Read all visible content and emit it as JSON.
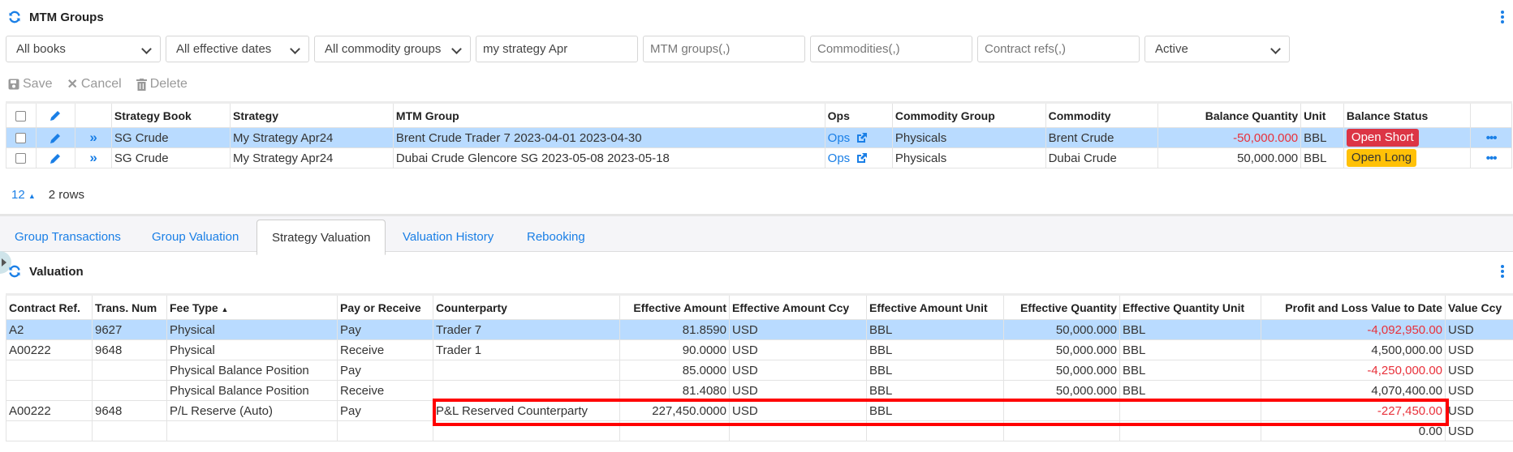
{
  "top_panel": {
    "title": "MTM Groups",
    "filters": {
      "books": "All books",
      "effective_dates": "All effective dates",
      "commodity_groups": "All commodity groups",
      "strategy_search_value": "my strategy Apr",
      "mtm_groups_placeholder": "MTM groups(,)",
      "commodities_placeholder": "Commodities(,)",
      "contract_refs_placeholder": "Contract refs(,)",
      "status": "Active"
    },
    "toolbar": {
      "save": "Save",
      "cancel": "Cancel",
      "delete": "Delete"
    },
    "table": {
      "columns": [
        "Strategy Book",
        "Strategy",
        "MTM Group",
        "Ops",
        "Commodity Group",
        "Commodity",
        "Balance Quantity",
        "Unit",
        "Balance Status"
      ],
      "rows": [
        {
          "strategy_book": "SG Crude",
          "strategy": "My Strategy Apr24",
          "mtm_group": "Brent Crude Trader 7 2023-04-01 2023-04-30",
          "ops": "Ops",
          "commodity_group": "Physicals",
          "commodity": "Brent Crude",
          "balance_quantity": "-50,000.000",
          "unit": "BBL",
          "balance_status": "Open Short",
          "selected": true
        },
        {
          "strategy_book": "SG Crude",
          "strategy": "My Strategy Apr24",
          "mtm_group": "Dubai Crude Glencore SG 2023-05-08 2023-05-18",
          "ops": "Ops",
          "commodity_group": "Physicals",
          "commodity": "Dubai Crude",
          "balance_quantity": "50,000.000",
          "unit": "BBL",
          "balance_status": "Open Long",
          "selected": false
        }
      ]
    },
    "pager": {
      "page_size": "12",
      "row_count": "2 rows"
    }
  },
  "tabs": [
    "Group Transactions",
    "Group Valuation",
    "Strategy Valuation",
    "Valuation History",
    "Rebooking"
  ],
  "active_tab": "Strategy Valuation",
  "valuation_panel": {
    "title": "Valuation",
    "table": {
      "columns": [
        "Contract Ref.",
        "Trans. Num",
        "Fee Type",
        "Pay or Receive",
        "Counterparty",
        "Effective Amount",
        "Effective Amount Ccy",
        "Effective Amount Unit",
        "Effective Quantity",
        "Effective Quantity Unit",
        "Profit and Loss Value to Date",
        "Value Ccy"
      ],
      "sort_indicator": "▲",
      "rows": [
        {
          "contract_ref": "A2",
          "trans_num": "9627",
          "fee_type": "Physical",
          "pay_receive": "Pay",
          "counterparty": "Trader 7",
          "eff_amount": "81.8590",
          "eff_amount_ccy": "USD",
          "eff_amount_unit": "BBL",
          "eff_qty": "50,000.000",
          "eff_qty_unit": "BBL",
          "pnl": "-4,092,950.00",
          "value_ccy": "USD",
          "selected": true
        },
        {
          "contract_ref": "A00222",
          "trans_num": "9648",
          "fee_type": "Physical",
          "pay_receive": "Receive",
          "counterparty": "Trader 1",
          "eff_amount": "90.0000",
          "eff_amount_ccy": "USD",
          "eff_amount_unit": "BBL",
          "eff_qty": "50,000.000",
          "eff_qty_unit": "BBL",
          "pnl": "4,500,000.00",
          "value_ccy": "USD"
        },
        {
          "contract_ref": "",
          "trans_num": "",
          "fee_type": "Physical Balance Position",
          "pay_receive": "Pay",
          "counterparty": "",
          "eff_amount": "85.0000",
          "eff_amount_ccy": "USD",
          "eff_amount_unit": "BBL",
          "eff_qty": "50,000.000",
          "eff_qty_unit": "BBL",
          "pnl": "-4,250,000.00",
          "value_ccy": "USD"
        },
        {
          "contract_ref": "",
          "trans_num": "",
          "fee_type": "Physical Balance Position",
          "pay_receive": "Receive",
          "counterparty": "",
          "eff_amount": "81.4080",
          "eff_amount_ccy": "USD",
          "eff_amount_unit": "BBL",
          "eff_qty": "50,000.000",
          "eff_qty_unit": "BBL",
          "pnl": "4,070,400.00",
          "value_ccy": "USD"
        },
        {
          "contract_ref": "A00222",
          "trans_num": "9648",
          "fee_type": "P/L Reserve (Auto)",
          "pay_receive": "Pay",
          "counterparty": "P&L Reserved Counterparty",
          "eff_amount": "227,450.0000",
          "eff_amount_ccy": "USD",
          "eff_amount_unit": "BBL",
          "eff_qty": "",
          "eff_qty_unit": "",
          "pnl": "-227,450.00",
          "value_ccy": "USD"
        },
        {
          "contract_ref": "",
          "trans_num": "",
          "fee_type": "",
          "pay_receive": "",
          "counterparty": "",
          "eff_amount": "",
          "eff_amount_ccy": "",
          "eff_amount_unit": "",
          "eff_qty": "",
          "eff_qty_unit": "",
          "pnl": "0.00",
          "value_ccy": "USD"
        }
      ]
    }
  },
  "colors": {
    "accent": "#1a7fe6",
    "negative": "#e8303a",
    "selected_row": "#b9dbff",
    "open_short": "#dc3545",
    "open_long": "#ffc107",
    "annotation": "#ff0000"
  }
}
